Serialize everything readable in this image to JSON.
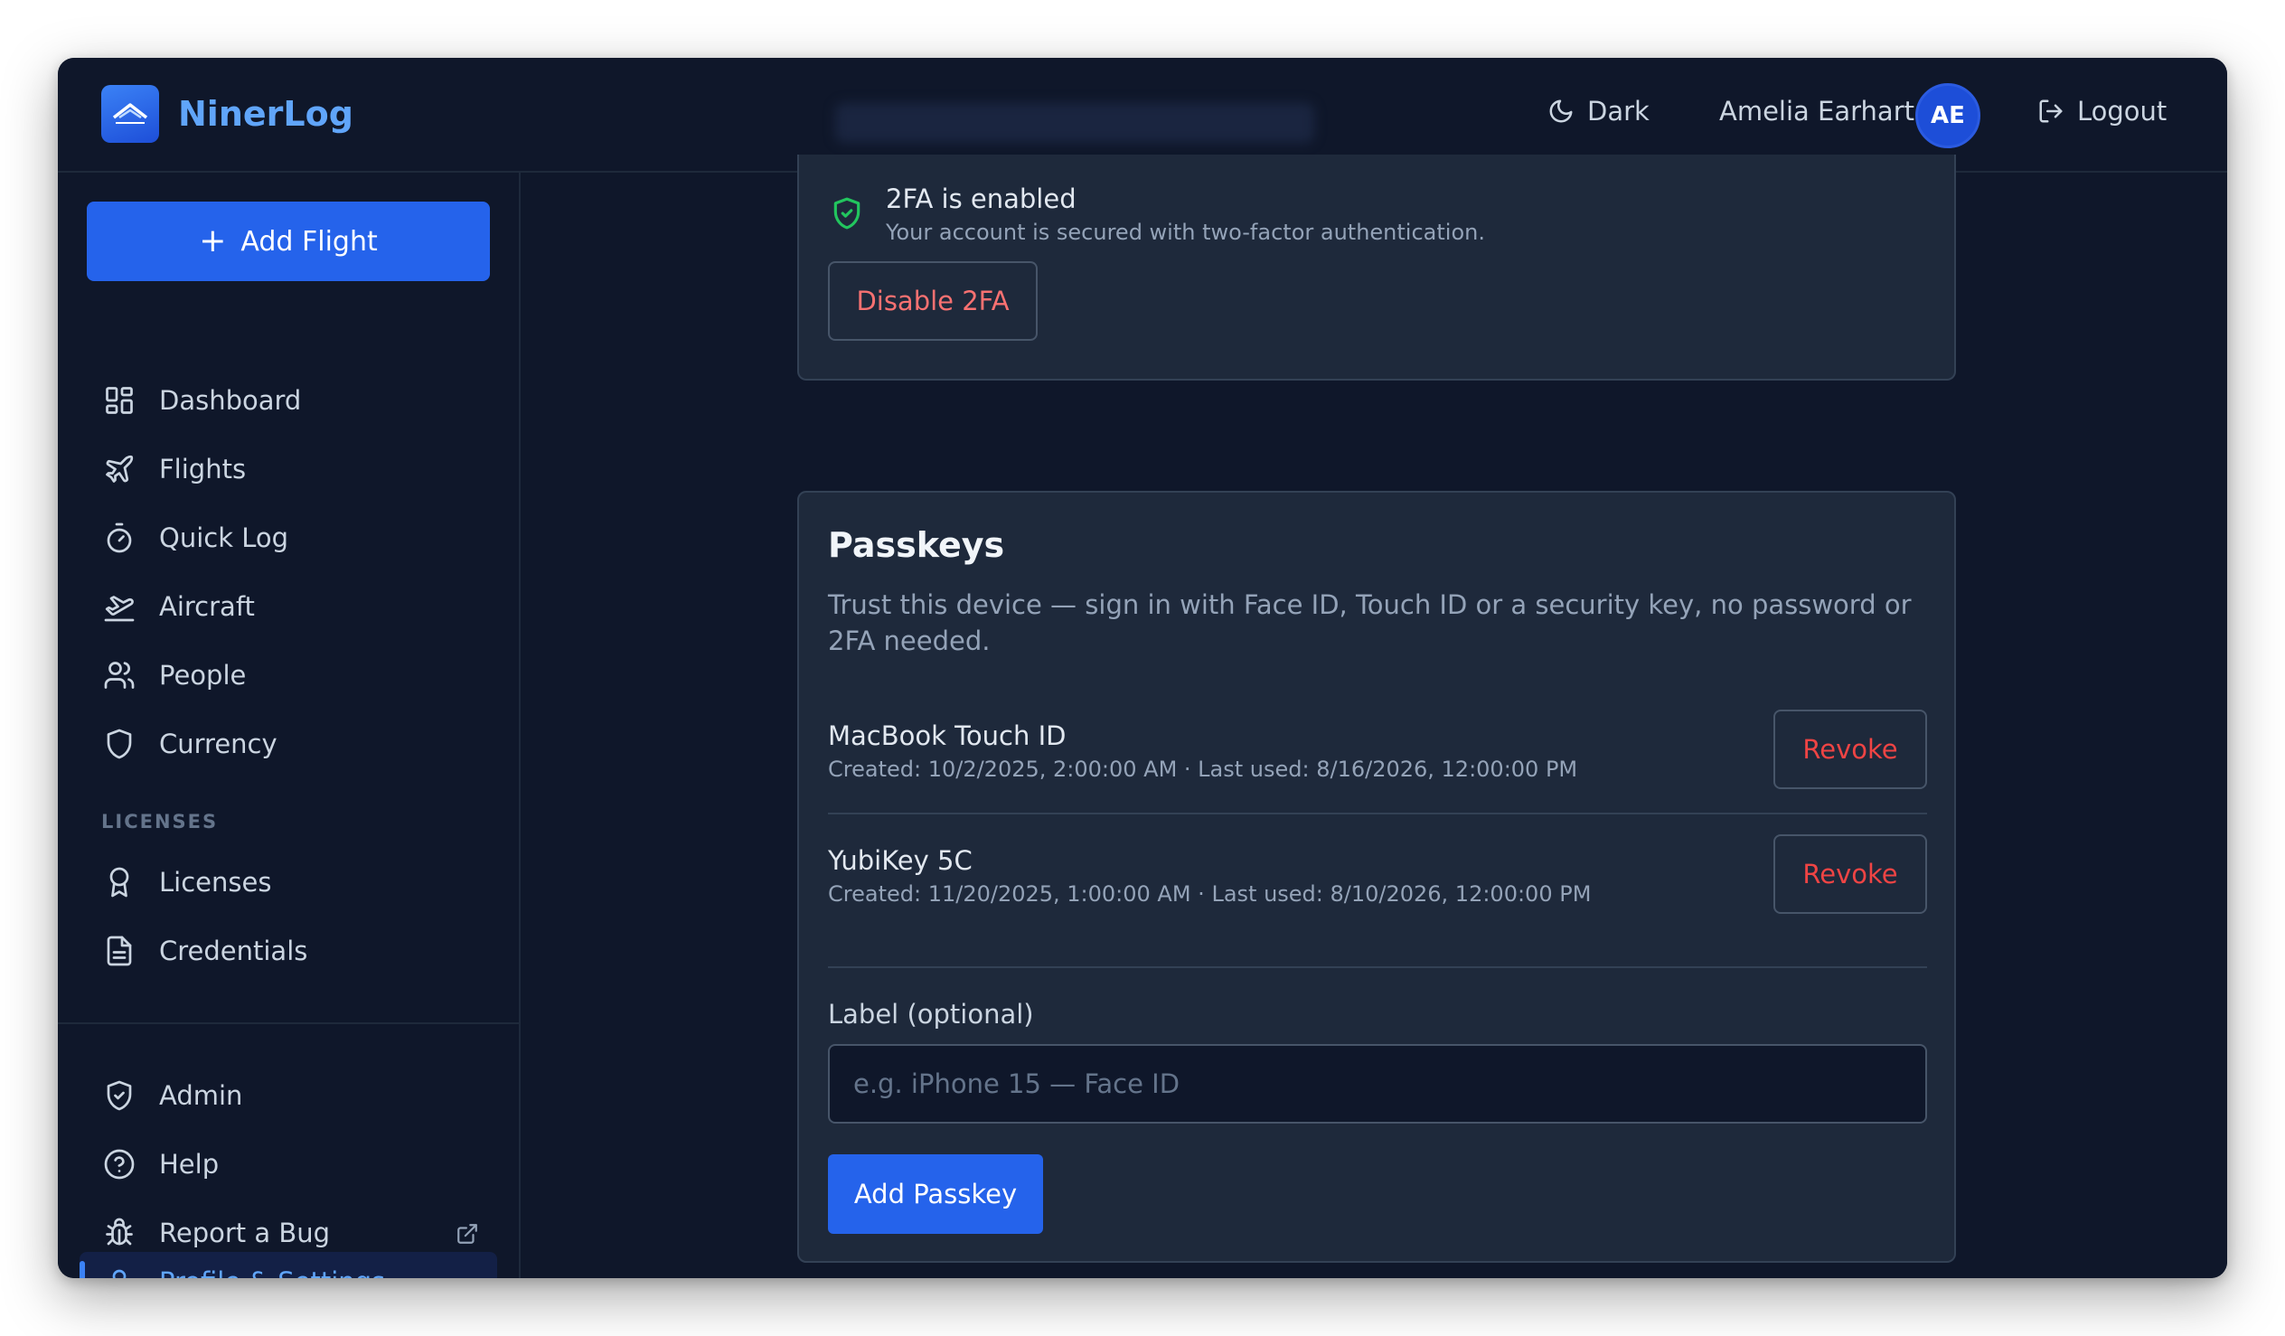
{
  "header": {
    "app_name": "NinerLog",
    "theme_label": "Dark",
    "user_name": "Amelia Earhart",
    "avatar_initials": "AE",
    "logout_label": "Logout"
  },
  "sidebar": {
    "add_flight_label": "Add Flight",
    "items": [
      {
        "label": "Dashboard",
        "icon": "dashboard-icon"
      },
      {
        "label": "Flights",
        "icon": "plane-icon"
      },
      {
        "label": "Quick Log",
        "icon": "timer-icon"
      },
      {
        "label": "Aircraft",
        "icon": "aircraft-icon"
      },
      {
        "label": "People",
        "icon": "people-icon"
      },
      {
        "label": "Currency",
        "icon": "shield-icon"
      }
    ],
    "licenses_section": "LICENSES",
    "license_items": [
      {
        "label": "Licenses",
        "icon": "award-icon"
      },
      {
        "label": "Credentials",
        "icon": "document-icon"
      }
    ],
    "bottom_items": [
      {
        "label": "Admin",
        "icon": "shield-check-icon"
      },
      {
        "label": "Help",
        "icon": "help-icon"
      },
      {
        "label": "Report a Bug",
        "icon": "bug-icon"
      },
      {
        "label": "Profile & Settings",
        "icon": "user-icon",
        "active": true
      }
    ]
  },
  "twofa": {
    "title": "2FA is enabled",
    "description": "Your account is secured with two-factor authentication.",
    "disable_label": "Disable 2FA"
  },
  "passkeys": {
    "title": "Passkeys",
    "description": "Trust this device — sign in with Face ID, Touch ID or a security key, no password or 2FA needed.",
    "items": [
      {
        "name": "MacBook Touch ID",
        "meta": "Created: 10/2/2025, 2:00:00 AM · Last used: 8/16/2026, 12:00:00 PM",
        "revoke_label": "Revoke"
      },
      {
        "name": "YubiKey 5C",
        "meta": "Created: 11/20/2025, 1:00:00 AM · Last used: 8/10/2026, 12:00:00 PM",
        "revoke_label": "Revoke"
      }
    ],
    "label_field_label": "Label (optional)",
    "label_placeholder": "e.g. iPhone 15 — Face ID",
    "label_value": "",
    "add_label": "Add Passkey"
  },
  "colors": {
    "accent": "#2563eb",
    "danger": "#ef4444",
    "success": "#22c55e",
    "background": "#0f172a",
    "card": "#1e293b"
  }
}
